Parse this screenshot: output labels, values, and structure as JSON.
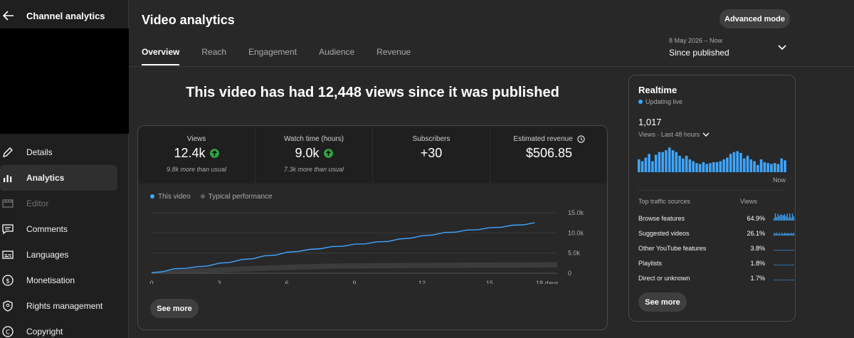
{
  "sidebar": {
    "title": "Channel analytics",
    "items": [
      {
        "label": "Details",
        "icon": "pencil-icon",
        "active": false,
        "disabled": false
      },
      {
        "label": "Analytics",
        "icon": "bar-chart-icon",
        "active": true,
        "disabled": false
      },
      {
        "label": "Editor",
        "icon": "film-strip-icon",
        "active": false,
        "disabled": true
      },
      {
        "label": "Comments",
        "icon": "comment-icon",
        "active": false,
        "disabled": false
      },
      {
        "label": "Languages",
        "icon": "subtitles-icon",
        "active": false,
        "disabled": false
      },
      {
        "label": "Monetisation",
        "icon": "dollar-icon",
        "active": false,
        "disabled": false
      },
      {
        "label": "Rights management",
        "icon": "shield-icon",
        "active": false,
        "disabled": false
      },
      {
        "label": "Copyright",
        "icon": "copyright-icon",
        "active": false,
        "disabled": false
      }
    ]
  },
  "header": {
    "title": "Video analytics",
    "advanced_mode": "Advanced mode",
    "tabs": [
      {
        "label": "Overview",
        "active": true
      },
      {
        "label": "Reach",
        "active": false
      },
      {
        "label": "Engagement",
        "active": false
      },
      {
        "label": "Audience",
        "active": false
      },
      {
        "label": "Revenue",
        "active": false
      }
    ],
    "date_range": {
      "dates": "8 May 2026 – Now",
      "label": "Since published"
    }
  },
  "headline": "This video has had 12,448 views since it was published",
  "metrics": [
    {
      "label": "Views",
      "value": "12.4k",
      "trend": "up",
      "note": "9.8k more than usual"
    },
    {
      "label": "Watch time (hours)",
      "value": "9.0k",
      "trend": "up",
      "note": "7.3k more than usual"
    },
    {
      "label": "Subscribers",
      "value": "+30",
      "trend": "",
      "note": ""
    },
    {
      "label": "Estimated revenue",
      "value": "$506.85",
      "trend": "",
      "note": "",
      "info_icon": "clock-icon"
    }
  ],
  "chart_data": {
    "type": "line",
    "legend": [
      "This video",
      "Typical performance"
    ],
    "x_ticks": [
      "0",
      "3",
      "6",
      "9",
      "12",
      "15",
      "18 days"
    ],
    "y_ticks": [
      "15.0k",
      "10.0k",
      "5.0k",
      "0"
    ],
    "ylim": [
      0,
      15000
    ],
    "xlim": [
      0,
      18
    ],
    "series": [
      {
        "name": "This video",
        "color": "#3ea6ff",
        "x": [
          0,
          0.5,
          1,
          1.5,
          2,
          2.5,
          3,
          3.5,
          4,
          4.5,
          5,
          5.5,
          6,
          6.5,
          7,
          7.5,
          8,
          8.5,
          9,
          9.5,
          10,
          10.5,
          11,
          11.5,
          12,
          12.5,
          13,
          13.5,
          14,
          14.5,
          15,
          15.5,
          16,
          16.5,
          17
        ],
        "y": [
          0,
          500,
          1000,
          1300,
          1500,
          1900,
          2400,
          2800,
          3300,
          3700,
          4200,
          4600,
          5100,
          5500,
          5800,
          6200,
          6500,
          6800,
          7100,
          7400,
          7700,
          8000,
          8400,
          8800,
          9200,
          9600,
          10000,
          10300,
          10600,
          10900,
          11200,
          11500,
          11800,
          12100,
          12448
        ]
      },
      {
        "name": "Typical performance",
        "color": "#606060",
        "x": [
          0,
          2,
          4,
          6,
          8,
          10,
          12,
          14,
          16,
          18
        ],
        "y": [
          0,
          800,
          1300,
          1700,
          2000,
          2100,
          2200,
          2250,
          2300,
          2350
        ]
      }
    ],
    "grid": true
  },
  "see_more": "See more",
  "realtime": {
    "title": "Realtime",
    "status": "Updating live",
    "count": "1,017",
    "subtitle": "Views · Last 48 hours",
    "now_label": "Now",
    "bars": [
      14,
      12,
      16,
      20,
      12,
      19,
      22,
      22,
      24,
      27,
      24,
      22,
      18,
      15,
      18,
      14,
      12,
      10,
      9,
      11,
      9,
      10,
      11,
      11,
      12,
      14,
      16,
      20,
      22,
      23,
      21,
      15,
      18,
      14,
      12,
      8,
      14,
      11,
      10,
      9,
      10,
      9,
      15,
      13
    ],
    "sources_header": "Top traffic sources",
    "views_header": "Views",
    "sources": [
      {
        "name": "Browse features",
        "pct": "64.9%",
        "share": 64.9
      },
      {
        "name": "Suggested videos",
        "pct": "26.1%",
        "share": 26.1
      },
      {
        "name": "Other YouTube features",
        "pct": "3.8%",
        "share": 3.8
      },
      {
        "name": "Playlists",
        "pct": "1.8%",
        "share": 1.8
      },
      {
        "name": "Direct or unknown",
        "pct": "1.7%",
        "share": 1.7
      }
    ],
    "see_more": "See more"
  },
  "colors": {
    "accent": "#3ea6ff",
    "up": "#2ba640",
    "background": "#282828"
  }
}
